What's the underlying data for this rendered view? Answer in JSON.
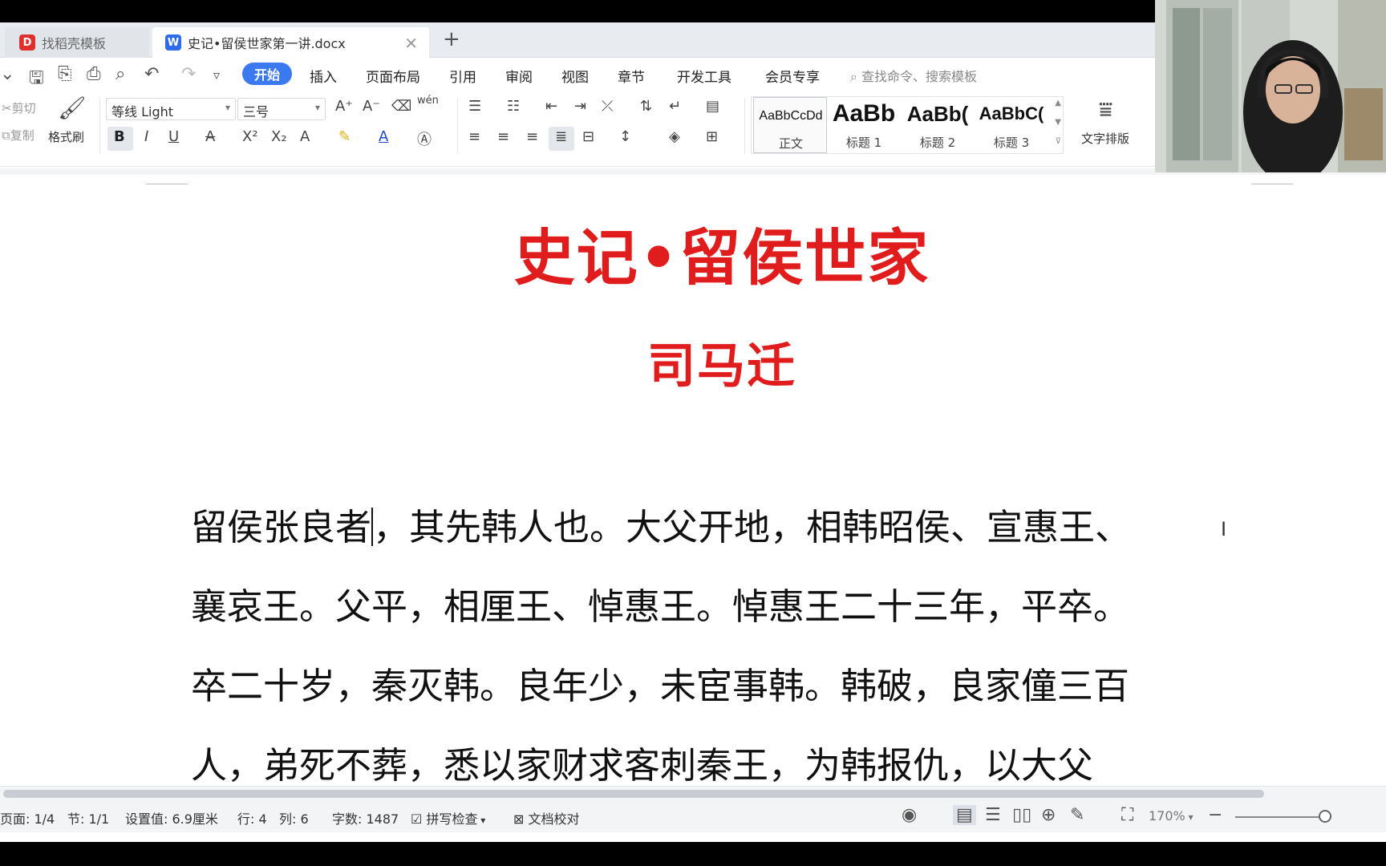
{
  "tabs": [
    {
      "label": "找稻壳模板"
    },
    {
      "label": "史记•留侯世家第一讲.docx"
    }
  ],
  "menu": {
    "items": [
      "开始",
      "插入",
      "页面布局",
      "引用",
      "审阅",
      "视图",
      "章节",
      "开发工具",
      "会员专享"
    ],
    "search_placeholder": "查找命令、搜索模板"
  },
  "ribbon": {
    "cut": "剪切",
    "copy": "复制",
    "format_painter": "格式刷",
    "font_name": "等线 Light",
    "font_size": "三号",
    "styles": [
      {
        "sample": "AaBbCcDd",
        "label": "正文"
      },
      {
        "sample": "AaBb",
        "label": "标题 1"
      },
      {
        "sample": "AaBb(",
        "label": "标题 2"
      },
      {
        "sample": "AaBbC(",
        "label": "标题 3"
      }
    ],
    "text_layout": "文字排版",
    "pinyin_glyph": "wén"
  },
  "document": {
    "title": "史记•留侯世家",
    "author": "司马迁",
    "lines": [
      "留侯张良者",
      "，其先韩人也。大父开地，相韩昭侯、宣惠王、",
      "襄哀王。父平，相厘王、悼惠王。悼惠王二十三年，平卒。",
      "卒二十岁，秦灭韩。良年少，未宦事韩。韩破，良家僮三百",
      "人，弟死不葬，悉以家财求客刺秦王，为韩报仇，以大父"
    ]
  },
  "status": {
    "page": "页面: 1/4",
    "section": "节: 1/1",
    "setting": "设置值: 6.9厘米",
    "row": "行: 4",
    "col": "列: 6",
    "words": "字数: 1487",
    "spellcheck": "拼写检查",
    "doc_check": "文档校对",
    "zoom": "170%"
  },
  "colors": {
    "accent": "#3b79f0",
    "title_red": "#e01c1c"
  }
}
